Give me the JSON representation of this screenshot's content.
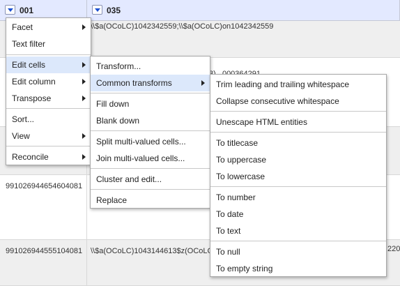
{
  "columns": [
    {
      "name": "001"
    },
    {
      "name": "035"
    }
  ],
  "rows": [
    {
      "id": "",
      "value": "\\\\$a(OCoLC)1042342559;\\\\$a(OCoLC)on1042342559"
    },
    {
      "id": "",
      "value": ""
    },
    {
      "id": "",
      "value": ""
    },
    {
      "id": "991026944654604081",
      "value": ""
    },
    {
      "id": "991026944555104081",
      "value": "\\\\$a(OCoLC)1043144613$z(OCoLC"
    }
  ],
  "hidden_fragments": {
    "row2_value": "3)...000364291",
    "row5_tail": "220"
  },
  "column_menu": {
    "items": [
      {
        "label": "Facet",
        "has_submenu": true
      },
      {
        "label": "Text filter",
        "has_submenu": false
      },
      {
        "label": "Edit cells",
        "has_submenu": true,
        "highlighted": true
      },
      {
        "label": "Edit column",
        "has_submenu": true
      },
      {
        "label": "Transpose",
        "has_submenu": true
      },
      {
        "label": "Sort...",
        "has_submenu": false
      },
      {
        "label": "View",
        "has_submenu": true
      },
      {
        "label": "Reconcile",
        "has_submenu": true
      }
    ]
  },
  "edit_cells_menu": {
    "items": [
      {
        "label": "Transform..."
      },
      {
        "label": "Common transforms",
        "has_submenu": true,
        "highlighted": true
      },
      {
        "label": "Fill down"
      },
      {
        "label": "Blank down"
      },
      {
        "label": "Split multi-valued cells..."
      },
      {
        "label": "Join multi-valued cells..."
      },
      {
        "label": "Cluster and edit..."
      },
      {
        "label": "Replace"
      }
    ]
  },
  "common_transforms_menu": {
    "items": [
      {
        "label": "Trim leading and trailing whitespace"
      },
      {
        "label": "Collapse consecutive whitespace"
      },
      {
        "label": "Unescape HTML entities"
      },
      {
        "label": "To titlecase"
      },
      {
        "label": "To uppercase"
      },
      {
        "label": "To lowercase"
      },
      {
        "label": "To number"
      },
      {
        "label": "To date"
      },
      {
        "label": "To text"
      },
      {
        "label": "To null"
      },
      {
        "label": "To empty string"
      }
    ]
  }
}
